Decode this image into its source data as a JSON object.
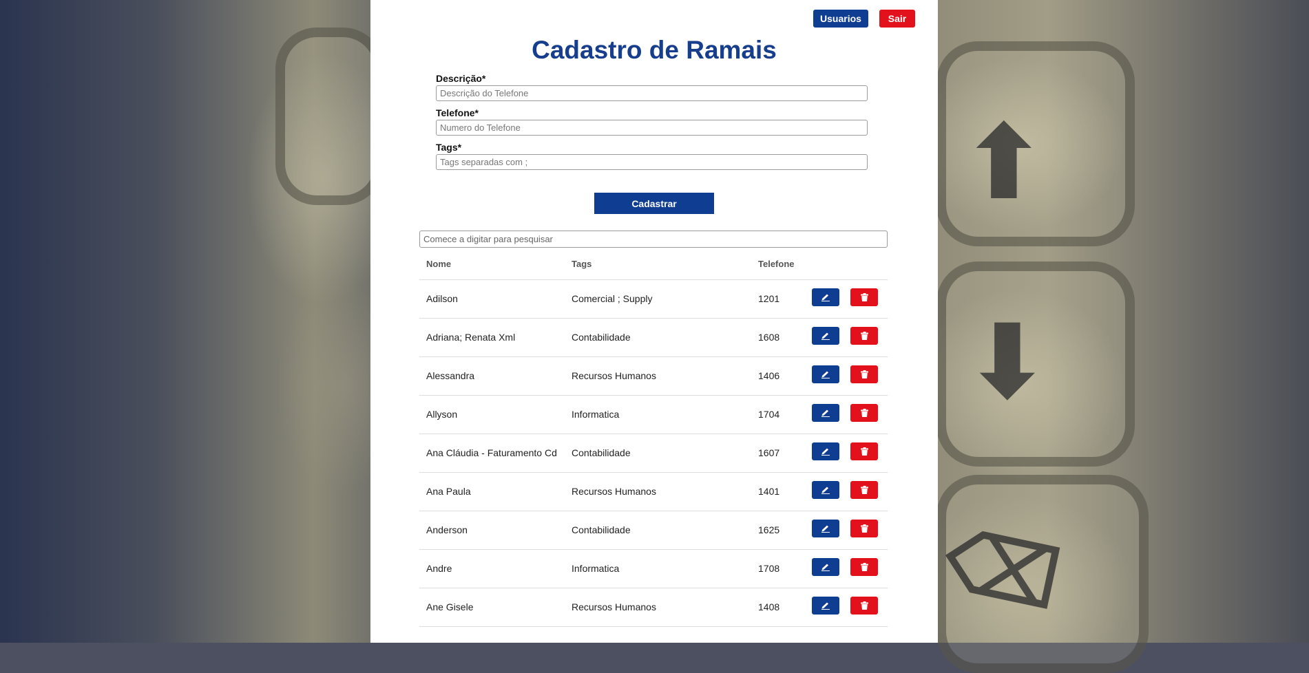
{
  "header": {
    "usuarios_label": "Usuarios",
    "sair_label": "Sair",
    "title": "Cadastro de Ramais"
  },
  "form": {
    "descricao": {
      "label": "Descrição*",
      "placeholder": "Descrição do Telefone",
      "value": ""
    },
    "telefone": {
      "label": "Telefone*",
      "placeholder": "Numero do Telefone",
      "value": ""
    },
    "tags": {
      "label": "Tags*",
      "placeholder": "Tags separadas com ;",
      "value": ""
    },
    "submit_label": "Cadastrar"
  },
  "search": {
    "placeholder": "Comece a digitar para pesquisar",
    "value": ""
  },
  "table": {
    "columns": [
      "Nome",
      "Tags",
      "Telefone"
    ],
    "rows": [
      {
        "nome": "Adilson",
        "tags": "Comercial ; Supply",
        "telefone": "1201"
      },
      {
        "nome": "Adriana; Renata Xml",
        "tags": "Contabilidade",
        "telefone": "1608"
      },
      {
        "nome": "Alessandra",
        "tags": "Recursos Humanos",
        "telefone": "1406"
      },
      {
        "nome": "Allyson",
        "tags": "Informatica",
        "telefone": "1704"
      },
      {
        "nome": "Ana Cláudia - Faturamento Cd",
        "tags": "Contabilidade",
        "telefone": "1607"
      },
      {
        "nome": "Ana Paula",
        "tags": "Recursos Humanos",
        "telefone": "1401"
      },
      {
        "nome": "Anderson",
        "tags": "Contabilidade",
        "telefone": "1625"
      },
      {
        "nome": "Andre",
        "tags": "Informatica",
        "telefone": "1708"
      },
      {
        "nome": "Ane Gisele",
        "tags": "Recursos Humanos",
        "telefone": "1408"
      }
    ],
    "row_actions": {
      "edit_icon": "pencil-icon",
      "delete_icon": "trash-icon"
    }
  },
  "colors": {
    "primary": "#0e3d91",
    "danger": "#e3111b",
    "title": "#163e8c"
  }
}
